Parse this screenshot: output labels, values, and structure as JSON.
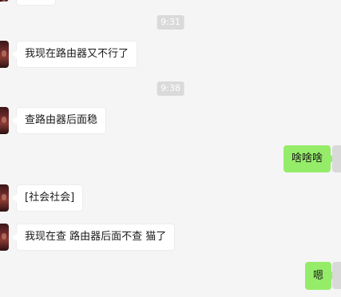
{
  "chat": {
    "timestamps": [
      "9:31",
      "9:38"
    ],
    "messages": [
      {
        "side": "in",
        "text": "我现在路由器又不行了"
      },
      {
        "side": "in",
        "text": "查路由器后面稳"
      },
      {
        "side": "out",
        "text": "啥啥啥"
      },
      {
        "side": "in",
        "text": "[社会社会]"
      },
      {
        "side": "in",
        "text": "我现在查 路由器后面不查 猫了"
      },
      {
        "side": "out",
        "text": "嗯"
      }
    ]
  },
  "colors": {
    "background": "#f5f5f5",
    "incoming_bubble": "#ffffff",
    "outgoing_bubble": "#95ec69",
    "time_pill": "#dadada"
  }
}
